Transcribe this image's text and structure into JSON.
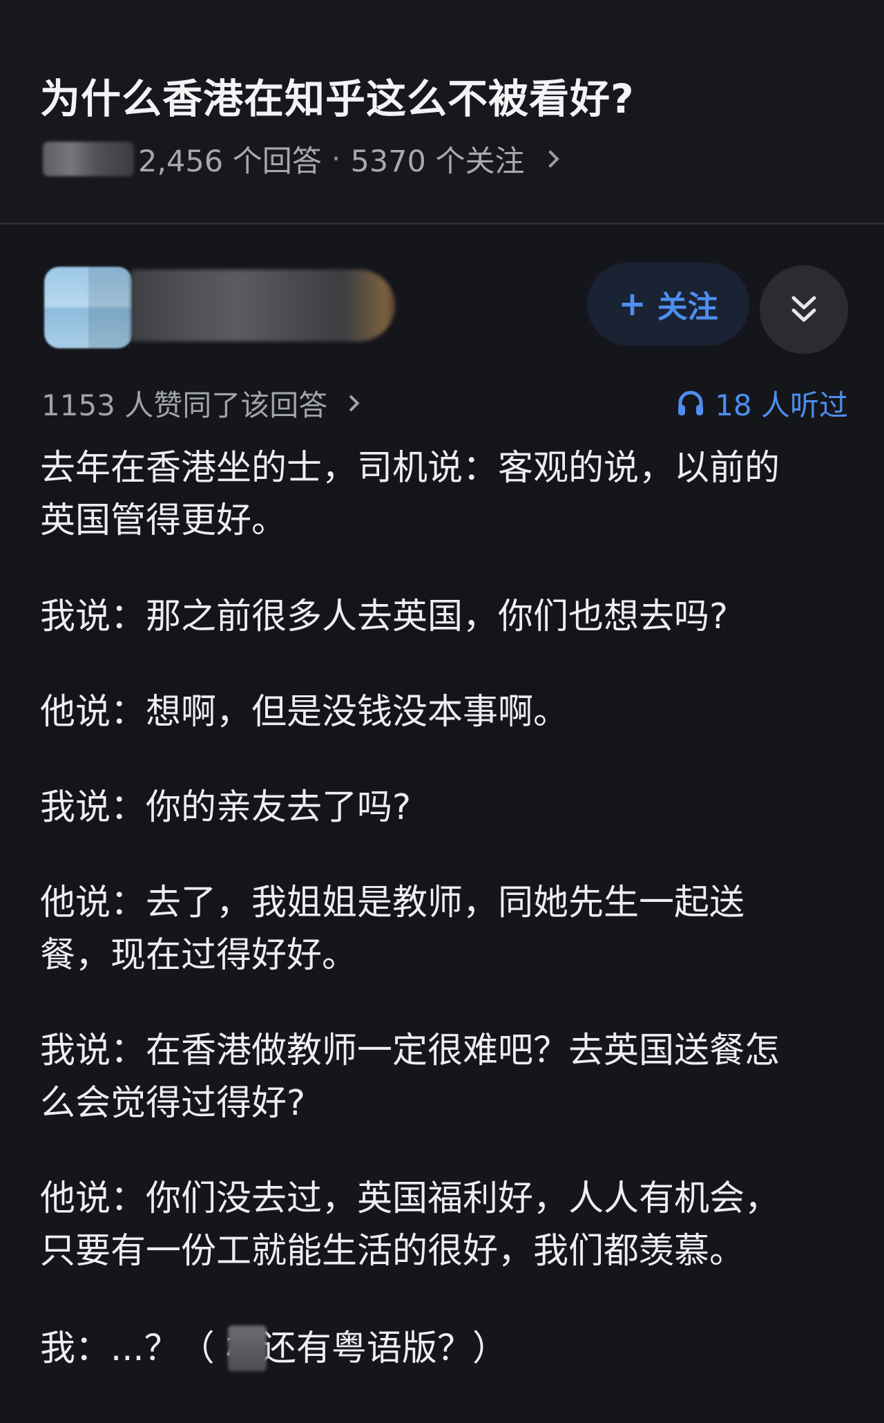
{
  "question": {
    "title": "为什么香港在知乎这么不被看好?",
    "answers_count": "2,456 个回答",
    "separator": "·",
    "followers_count": "5370 个关注"
  },
  "author": {
    "follow_label": "关注",
    "follow_icon": "plus-icon",
    "collapse_icon": "double-chevron-down-icon"
  },
  "stats": {
    "upvotes": "1153 人赞同了该回答",
    "listens": "18 人听过",
    "listen_icon": "headphones-icon"
  },
  "answer": {
    "paragraphs": [
      "去年在香港坐的士，司机说：客观的说，以前的\n英国管得更好。",
      "我说：那之前很多人去英国，你们也想去吗?",
      "他说：想啊，但是没钱没本事啊。",
      "我说：你的亲友去了吗?",
      "他说：去了，我姐姐是教师，同她先生一起送\n餐，现在过得好好。",
      "我说：在香港做教师一定很难吧？去英国送餐怎\n么会觉得过得好?",
      "他说：你们没去过，英国福利好，人人有机会，\n只要有一份工就能生活的很好，我们都羡慕。",
      "我：...？（ 林还有粤语版？）"
    ]
  },
  "colors": {
    "background": "#14151a",
    "accent": "#4e8ef0",
    "text_primary": "#eceef2",
    "text_secondary": "#a2a4ab"
  }
}
